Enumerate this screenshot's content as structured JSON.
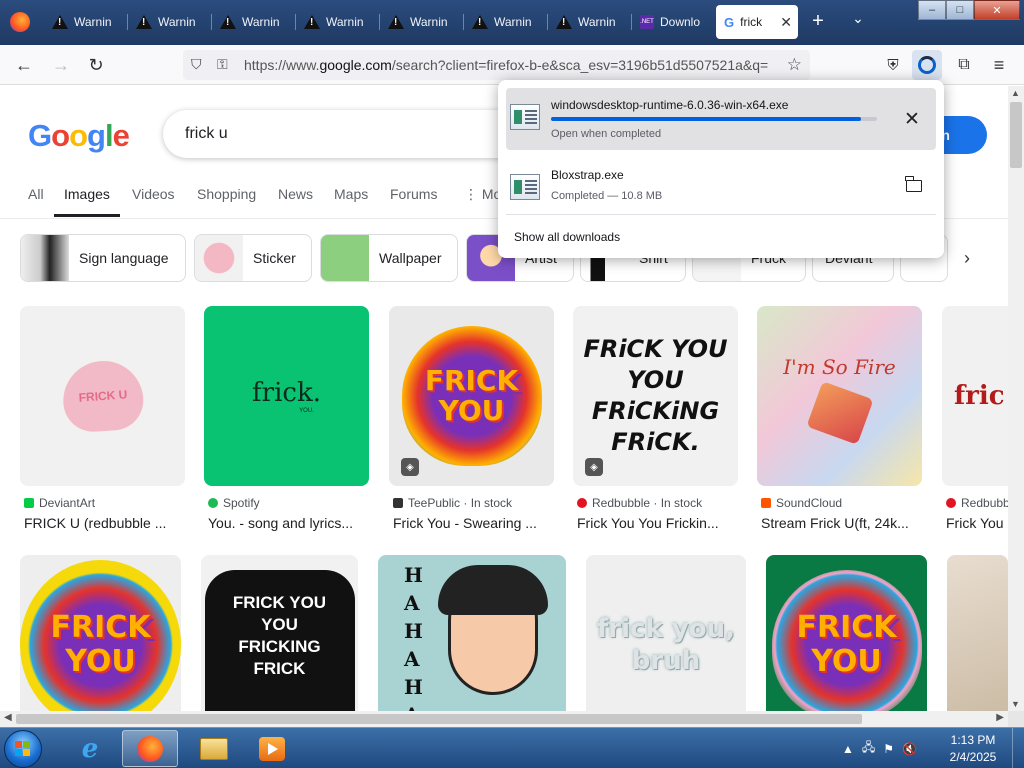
{
  "browser": {
    "tabs": [
      {
        "label": "Warnin",
        "favicon": "warning-icon"
      },
      {
        "label": "Warnin",
        "favicon": "warning-icon"
      },
      {
        "label": "Warnin",
        "favicon": "warning-icon"
      },
      {
        "label": "Warnin",
        "favicon": "warning-icon"
      },
      {
        "label": "Warnin",
        "favicon": "warning-icon"
      },
      {
        "label": "Warnin",
        "favicon": "warning-icon"
      },
      {
        "label": "Warnin",
        "favicon": "warning-icon"
      },
      {
        "label": "Downlo",
        "favicon": "dotnet-icon",
        "favicon_text": ".NET"
      },
      {
        "label": "frick",
        "favicon": "google-icon",
        "active": true
      }
    ],
    "url": {
      "prefix": "https://www.",
      "domain": "google.com",
      "path": "/search?client=firefox-b-e&sca_esv=3196b51d5507521a&q="
    },
    "window_controls": {
      "minimize": "–",
      "maximize": "□",
      "close": "✕"
    }
  },
  "downloads": {
    "items": [
      {
        "name": "windowsdesktop-runtime-6.0.36-win-x64.exe",
        "status": "Open when completed",
        "progress": 0.95,
        "action": "cancel"
      },
      {
        "name": "Bloxstrap.exe",
        "status": "Completed — 10.8 MB",
        "action": "show-in-folder"
      }
    ],
    "show_all": "Show all downloads"
  },
  "google": {
    "logo_letters": [
      "G",
      "o",
      "o",
      "g",
      "l",
      "e"
    ],
    "logo_colors": [
      "#4285F4",
      "#EA4335",
      "#FBBC05",
      "#4285F4",
      "#34A853",
      "#EA4335"
    ],
    "query": "frick u",
    "signin_label": "n in",
    "tabs": [
      "All",
      "Images",
      "Videos",
      "Shopping",
      "News",
      "Maps",
      "Forums",
      "Mo"
    ],
    "active_tab": "Images",
    "chips": [
      "Sign language",
      "Sticker",
      "Wallpaper",
      "Artist",
      "Shirt",
      "Fruck",
      "Deviant"
    ],
    "results_row1": [
      {
        "source": "DeviantArt",
        "title": "FRICK U (redbubble ...",
        "image_text": "FRICK U"
      },
      {
        "source": "Spotify",
        "title": "You. - song and lyrics...",
        "image_text": "frick.",
        "image_subtext": "YOU."
      },
      {
        "source": "TeePublic · In stock",
        "title": "Frick You - Swearing ...",
        "image_text": "FRICK YOU"
      },
      {
        "source": "Redbubble · In stock",
        "title": "Frick You You Frickin...",
        "image_text": "FRiCK YOU YOU FRiCKiNG FRiCK."
      },
      {
        "source": "SoundCloud",
        "title": "Stream Frick U(ft, 24k...",
        "image_text": "I'm So Fire"
      },
      {
        "source": "Redbubble",
        "title": "Frick You",
        "image_text": "fric"
      }
    ],
    "results_row2": [
      {
        "image_text": "FRICK YOU"
      },
      {
        "image_text": "FRICK YOU YOU FRICKING FRICK"
      },
      {
        "image_text": "HAHAHA"
      },
      {
        "image_text": "frick you, bruh"
      },
      {
        "image_text": "FRICK YOU"
      },
      {
        "image_text": ""
      }
    ]
  },
  "taskbar": {
    "clock_time": "1:13 PM",
    "clock_date": "2/4/2025"
  },
  "colors": {
    "google_blue": "#1a73e8",
    "firefox_progress": "#0061e0",
    "taskbar": "#1e4a80"
  }
}
